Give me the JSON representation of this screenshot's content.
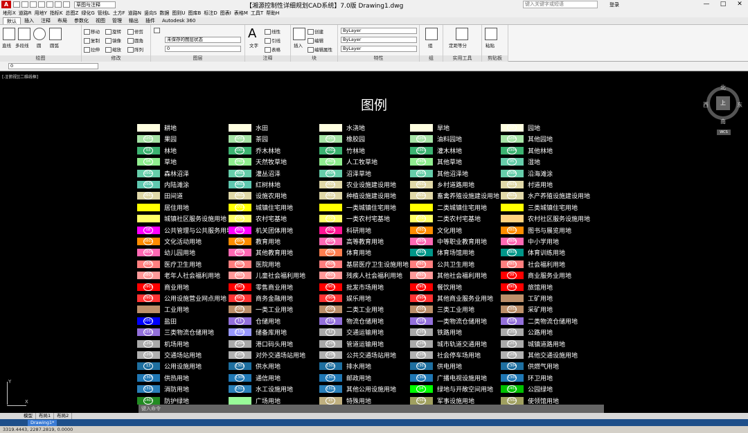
{
  "titlebar": {
    "workspace": "草图与注释",
    "title": "【湘源控制性详细规划CAD系统】7.0版    Drawing1.dwg",
    "search_placeholder": "键入关键字或短语",
    "login": "登录",
    "min": "—",
    "max": "□",
    "close": "✕"
  },
  "menu": [
    "地形X",
    "道路R",
    "用地Y",
    "指标K",
    "总图Z",
    "绿化G",
    "管线L",
    "土方F",
    "道路N",
    "竖向S",
    "数据",
    "图则U",
    "图库B",
    "标注D",
    "图表I",
    "表格M",
    "工具T",
    "帮助H"
  ],
  "ribbon_tabs": [
    "默认",
    "插入",
    "注释",
    "布局",
    "参数化",
    "视图",
    "管理",
    "输出",
    "插件",
    "Autodesk 360"
  ],
  "ribbon": {
    "draw": {
      "label": "绘图",
      "line": "直线",
      "polyline": "多段线",
      "circle": "圆",
      "arc": "圆弧"
    },
    "modify": {
      "label": "修改",
      "move": "移动",
      "rotate": "旋转",
      "trim": "修剪",
      "copy": "复制",
      "mirror": "镜像",
      "fillet": "圆角",
      "stretch": "拉伸",
      "scale": "缩放",
      "array": "阵列"
    },
    "layer": {
      "label": "图层",
      "state": "未保存的图层状态",
      "current": "0"
    },
    "annotation": {
      "label": "注释",
      "text": "文字",
      "linear": "线性",
      "leader": "引线",
      "table": "表格"
    },
    "block": {
      "label": "块",
      "insert": "插入",
      "create": "创建",
      "edit": "编辑",
      "attr": "编辑属性"
    },
    "properties": {
      "label": "特性",
      "color": "ByLayer",
      "linetype": "ByLayer",
      "lineweight": "ByLayer"
    },
    "group": {
      "label": "组",
      "group": "组"
    },
    "utilities": {
      "label": "实用工具",
      "measure": "定距等分"
    },
    "clipboard": {
      "label": "剪贴板",
      "paste": "粘贴"
    }
  },
  "docbar": {
    "combo": "0"
  },
  "canvas": {
    "view_label": "[-][俯视][二维线框]",
    "legend_title": "图例",
    "compass": {
      "n": "北",
      "s": "南",
      "e": "东",
      "w": "西",
      "top": "上",
      "wcs": "WCS"
    },
    "ucs": {
      "x": "X",
      "y": "Y"
    }
  },
  "command_placeholder": "键入命令",
  "layout_tabs": [
    "模型",
    "布局1",
    "布局2"
  ],
  "taskbar": {
    "task": "Drawing1*"
  },
  "status": {
    "coords": "3319.4443, 2287.2819, 0.0000"
  },
  "legend": [
    [
      {
        "code": "",
        "label": "耕地",
        "color": "#ffffe0"
      },
      {
        "code": "0202",
        "label": "果园",
        "color": "#a6e3a6"
      },
      {
        "code": "03",
        "label": "林地",
        "color": "#3cb371"
      },
      {
        "code": "04",
        "label": "草地",
        "color": "#90ee90"
      },
      {
        "code": "0502",
        "label": "森林沼泽",
        "color": "#66cdaa"
      },
      {
        "code": "0506",
        "label": "内陆滩涂",
        "color": "#5fc8b0"
      },
      {
        "code": "0601",
        "label": "田间道",
        "color": "#e0d8a8"
      },
      {
        "code": "",
        "label": "居住用地",
        "color": "#ffff00"
      },
      {
        "code": "",
        "label": "城镇社区服务设施用地",
        "color": "#ffff66"
      },
      {
        "code": "08",
        "label": "公共管理与公共服务用地",
        "color": "#ff00ff"
      },
      {
        "code": "080302",
        "label": "文化活动用地",
        "color": "#ff8c00"
      },
      {
        "code": "080404",
        "label": "幼儿园用地",
        "color": "#ff69b4"
      },
      {
        "code": "0806",
        "label": "医疗卫生用地",
        "color": "#ff7f7f"
      },
      {
        "code": "080701",
        "label": "老年人社会福利用地",
        "color": "#ff9999"
      },
      {
        "code": "0901",
        "label": "商业用地",
        "color": "#ff0000"
      },
      {
        "code": "090105",
        "label": "公用设施营业网点用地",
        "color": "#ff3333"
      },
      {
        "code": "",
        "label": "工业用地",
        "color": "#bc8f6a"
      },
      {
        "code": "1003",
        "label": "盐田",
        "color": "#0000ff"
      },
      {
        "code": "110103",
        "label": "三类物流仓储用地",
        "color": "#9370db"
      },
      {
        "code": "1202",
        "label": "机场用地",
        "color": "#a9a9a9"
      },
      {
        "code": "1208",
        "label": "交通场站用地",
        "color": "#b0b0b0"
      },
      {
        "code": "13",
        "label": "公用设施用地",
        "color": "#1e6fa0"
      },
      {
        "code": "1305",
        "label": "供热用地",
        "color": "#1f77b4"
      },
      {
        "code": "1310",
        "label": "消防用地",
        "color": "#2a7fb8"
      },
      {
        "code": "1403",
        "label": "防护绿地",
        "color": "#228b22"
      }
    ],
    [
      {
        "code": "",
        "label": "水田",
        "color": "#ffffe0"
      },
      {
        "code": "0201",
        "label": "茶园",
        "color": "#a6e3a6"
      },
      {
        "code": "0301",
        "label": "乔木林地",
        "color": "#3cb371"
      },
      {
        "code": "0401",
        "label": "天然牧草地",
        "color": "#90ee90"
      },
      {
        "code": "0503",
        "label": "灌丛沼泽",
        "color": "#66cdaa"
      },
      {
        "code": "0603",
        "label": "红树林地",
        "color": "#5fc8b0"
      },
      {
        "code": "0602",
        "label": "设施农用地",
        "color": "#e0d8a8"
      },
      {
        "code": "0701",
        "label": "城镇住宅用地",
        "color": "#ffff00"
      },
      {
        "code": "0704",
        "label": "农村宅基地",
        "color": "#ffff66"
      },
      {
        "code": "0801",
        "label": "机关团体用地",
        "color": "#ff00ff"
      },
      {
        "code": "0804",
        "label": "教育用地",
        "color": "#ff8c00"
      },
      {
        "code": "080405",
        "label": "其他教育用地",
        "color": "#ff69b4"
      },
      {
        "code": "080601",
        "label": "医院用地",
        "color": "#ff7f7f"
      },
      {
        "code": "080702",
        "label": "儿童社会福利用地",
        "color": "#ff9999"
      },
      {
        "code": "090101",
        "label": "零售商业用地",
        "color": "#ff0000"
      },
      {
        "code": "0903",
        "label": "商务金融用地",
        "color": "#ff3333"
      },
      {
        "code": "100101",
        "label": "一类工业用地",
        "color": "#bc8f6a"
      },
      {
        "code": "11",
        "label": "仓储用地",
        "color": "#9370db"
      },
      {
        "code": "1102",
        "label": "储备库用地",
        "color": "#9999ff"
      },
      {
        "code": "1204",
        "label": "港口码头用地",
        "color": "#a9a9a9"
      },
      {
        "code": "1209",
        "label": "对外交通场站用地",
        "color": "#b0b0b0"
      },
      {
        "code": "1301",
        "label": "供水用地",
        "color": "#1e6fa0"
      },
      {
        "code": "1306",
        "label": "通信用地",
        "color": "#1f77b4"
      },
      {
        "code": "1311",
        "label": "水工设施用地",
        "color": "#2a7fb8"
      },
      {
        "code": "",
        "label": "广场用地",
        "color": "#98fb98"
      }
    ],
    [
      {
        "code": "",
        "label": "水浇地",
        "color": "#ffffe0"
      },
      {
        "code": "0203",
        "label": "橡胶园",
        "color": "#a6e3a6"
      },
      {
        "code": "0302",
        "label": "竹林地",
        "color": "#3cb371"
      },
      {
        "code": "0403",
        "label": "人工牧草地",
        "color": "#90ee90"
      },
      {
        "code": "0504",
        "label": "沼泽草地",
        "color": "#66cdaa"
      },
      {
        "code": "0601",
        "label": "农业设施建设用地",
        "color": "#e0d8a8"
      },
      {
        "code": "0602",
        "label": "种植设施建设用地",
        "color": "#e0d8a8"
      },
      {
        "code": "",
        "label": "一类城镇住宅用地",
        "color": "#ffff00"
      },
      {
        "code": "070301",
        "label": "一类农村宅基地",
        "color": "#ffff66"
      },
      {
        "code": "0802",
        "label": "科研用地",
        "color": "#ff1493"
      },
      {
        "code": "080401",
        "label": "高等教育用地",
        "color": "#ff69b4"
      },
      {
        "code": "0805",
        "label": "体育用地",
        "color": "#ff7f50"
      },
      {
        "code": "080602",
        "label": "基层医疗卫生设施用地",
        "color": "#ff7f7f"
      },
      {
        "code": "080703",
        "label": "残疾人社会福利用地",
        "color": "#ff9999"
      },
      {
        "code": "090102",
        "label": "批发市场用地",
        "color": "#ff0000"
      },
      {
        "code": "0904",
        "label": "娱乐用地",
        "color": "#ff3333"
      },
      {
        "code": "100102",
        "label": "二类工业用地",
        "color": "#bc8f6a"
      },
      {
        "code": "1101",
        "label": "物流仓储用地",
        "color": "#9370db"
      },
      {
        "code": "12",
        "label": "交通运输用地",
        "color": "#a9a9a9"
      },
      {
        "code": "1205",
        "label": "管道运输用地",
        "color": "#a9a9a9"
      },
      {
        "code": "120802",
        "label": "公共交通场站用地",
        "color": "#b0b0b0"
      },
      {
        "code": "1302",
        "label": "排水用地",
        "color": "#1e6fa0"
      },
      {
        "code": "1307",
        "label": "邮政用地",
        "color": "#1f77b4"
      },
      {
        "code": "1312",
        "label": "其他公用设施用地",
        "color": "#2a7fb8"
      },
      {
        "code": "15",
        "label": "特殊用地",
        "color": "#c0b080"
      }
    ],
    [
      {
        "code": "",
        "label": "旱地",
        "color": "#ffffe0"
      },
      {
        "code": "0204",
        "label": "油料园地",
        "color": "#a6e3a6"
      },
      {
        "code": "0303",
        "label": "灌木林地",
        "color": "#3cb371"
      },
      {
        "code": "0404",
        "label": "其他草地",
        "color": "#90ee90"
      },
      {
        "code": "0505",
        "label": "其他沼泽地",
        "color": "#66cdaa"
      },
      {
        "code": "0602",
        "label": "乡村道路用地",
        "color": "#e0d8a8"
      },
      {
        "code": "060202",
        "label": "畜禽养殖设施建设用地",
        "color": "#e0d8a8"
      },
      {
        "code": "",
        "label": "二类城镇住宅用地",
        "color": "#ffff00"
      },
      {
        "code": "070302",
        "label": "二类农村宅基地",
        "color": "#ffff66"
      },
      {
        "code": "0803",
        "label": "文化用地",
        "color": "#ff8c00"
      },
      {
        "code": "080402",
        "label": "中等职业教育用地",
        "color": "#ff69b4"
      },
      {
        "code": "080501",
        "label": "体育场馆用地",
        "color": "#009688"
      },
      {
        "code": "0807",
        "label": "公共卫生用地",
        "color": "#ff7f7f"
      },
      {
        "code": "080704",
        "label": "其他社会福利用地",
        "color": "#ff9999"
      },
      {
        "code": "090103",
        "label": "餐饮用地",
        "color": "#ff0000"
      },
      {
        "code": "0904",
        "label": "其他商业服务业用地",
        "color": "#ff3333"
      },
      {
        "code": "100103",
        "label": "三类工业用地",
        "color": "#bc8f6a"
      },
      {
        "code": "110101",
        "label": "一类物流仓储用地",
        "color": "#9370db"
      },
      {
        "code": "1201",
        "label": "铁路用地",
        "color": "#a9a9a9"
      },
      {
        "code": "1206",
        "label": "城市轨道交通用地",
        "color": "#a9a9a9"
      },
      {
        "code": "1208",
        "label": "社会停车场用地",
        "color": "#b0b0b0"
      },
      {
        "code": "1303",
        "label": "供电用地",
        "color": "#1e6fa0"
      },
      {
        "code": "1308",
        "label": "广播电视设施用地",
        "color": "#1f77b4"
      },
      {
        "code": "14",
        "label": "绿地与开敞空间用地",
        "color": "#00ff00"
      },
      {
        "code": "1501",
        "label": "军事设施用地",
        "color": "#a0a060"
      }
    ],
    [
      {
        "code": "02",
        "label": "园地",
        "color": "#ffffe0"
      },
      {
        "code": "0204",
        "label": "其他园地",
        "color": "#a6e3a6"
      },
      {
        "code": "0304",
        "label": "其他林地",
        "color": "#3cb371"
      },
      {
        "code": "05",
        "label": "湿地",
        "color": "#66cdaa"
      },
      {
        "code": "0506",
        "label": "沿海滩涂",
        "color": "#66cdaa"
      },
      {
        "code": "060102",
        "label": "村道用地",
        "color": "#e0d8a8"
      },
      {
        "code": "060203",
        "label": "水产养殖设施建设用地",
        "color": "#e0d8a8"
      },
      {
        "code": "",
        "label": "三类城镇住宅用地",
        "color": "#ffff00"
      },
      {
        "code": "",
        "label": "农村社区服务设施用地",
        "color": "#ffd27f"
      },
      {
        "code": "080301",
        "label": "图书与展览用地",
        "color": "#ff8c00"
      },
      {
        "code": "080403",
        "label": "中小学用地",
        "color": "#ff69b4"
      },
      {
        "code": "080502",
        "label": "体育训练用地",
        "color": "#009688"
      },
      {
        "code": "0807",
        "label": "社会福利用地",
        "color": "#ff7f7f"
      },
      {
        "code": "09",
        "label": "商业服务业用地",
        "color": "#ff0000"
      },
      {
        "code": "090104",
        "label": "旅馆用地",
        "color": "#ff0000"
      },
      {
        "code": "",
        "label": "工矿用地",
        "color": "#bc8f6a"
      },
      {
        "code": "1002",
        "label": "采矿用地",
        "color": "#bc8f6a"
      },
      {
        "code": "110102",
        "label": "二类物流仓储用地",
        "color": "#9370db"
      },
      {
        "code": "1202",
        "label": "公路用地",
        "color": "#a9a9a9"
      },
      {
        "code": "1207",
        "label": "城镇道路用地",
        "color": "#a9a9a9"
      },
      {
        "code": "1209",
        "label": "其他交通设施用地",
        "color": "#b0b0b0"
      },
      {
        "code": "1304",
        "label": "供燃气用地",
        "color": "#1e6fa0"
      },
      {
        "code": "1309",
        "label": "环卫用地",
        "color": "#1f77b4"
      },
      {
        "code": "1401",
        "label": "公园绿地",
        "color": "#00c000"
      },
      {
        "code": "1502",
        "label": "使领馆用地",
        "color": "#a0a060"
      }
    ]
  ]
}
